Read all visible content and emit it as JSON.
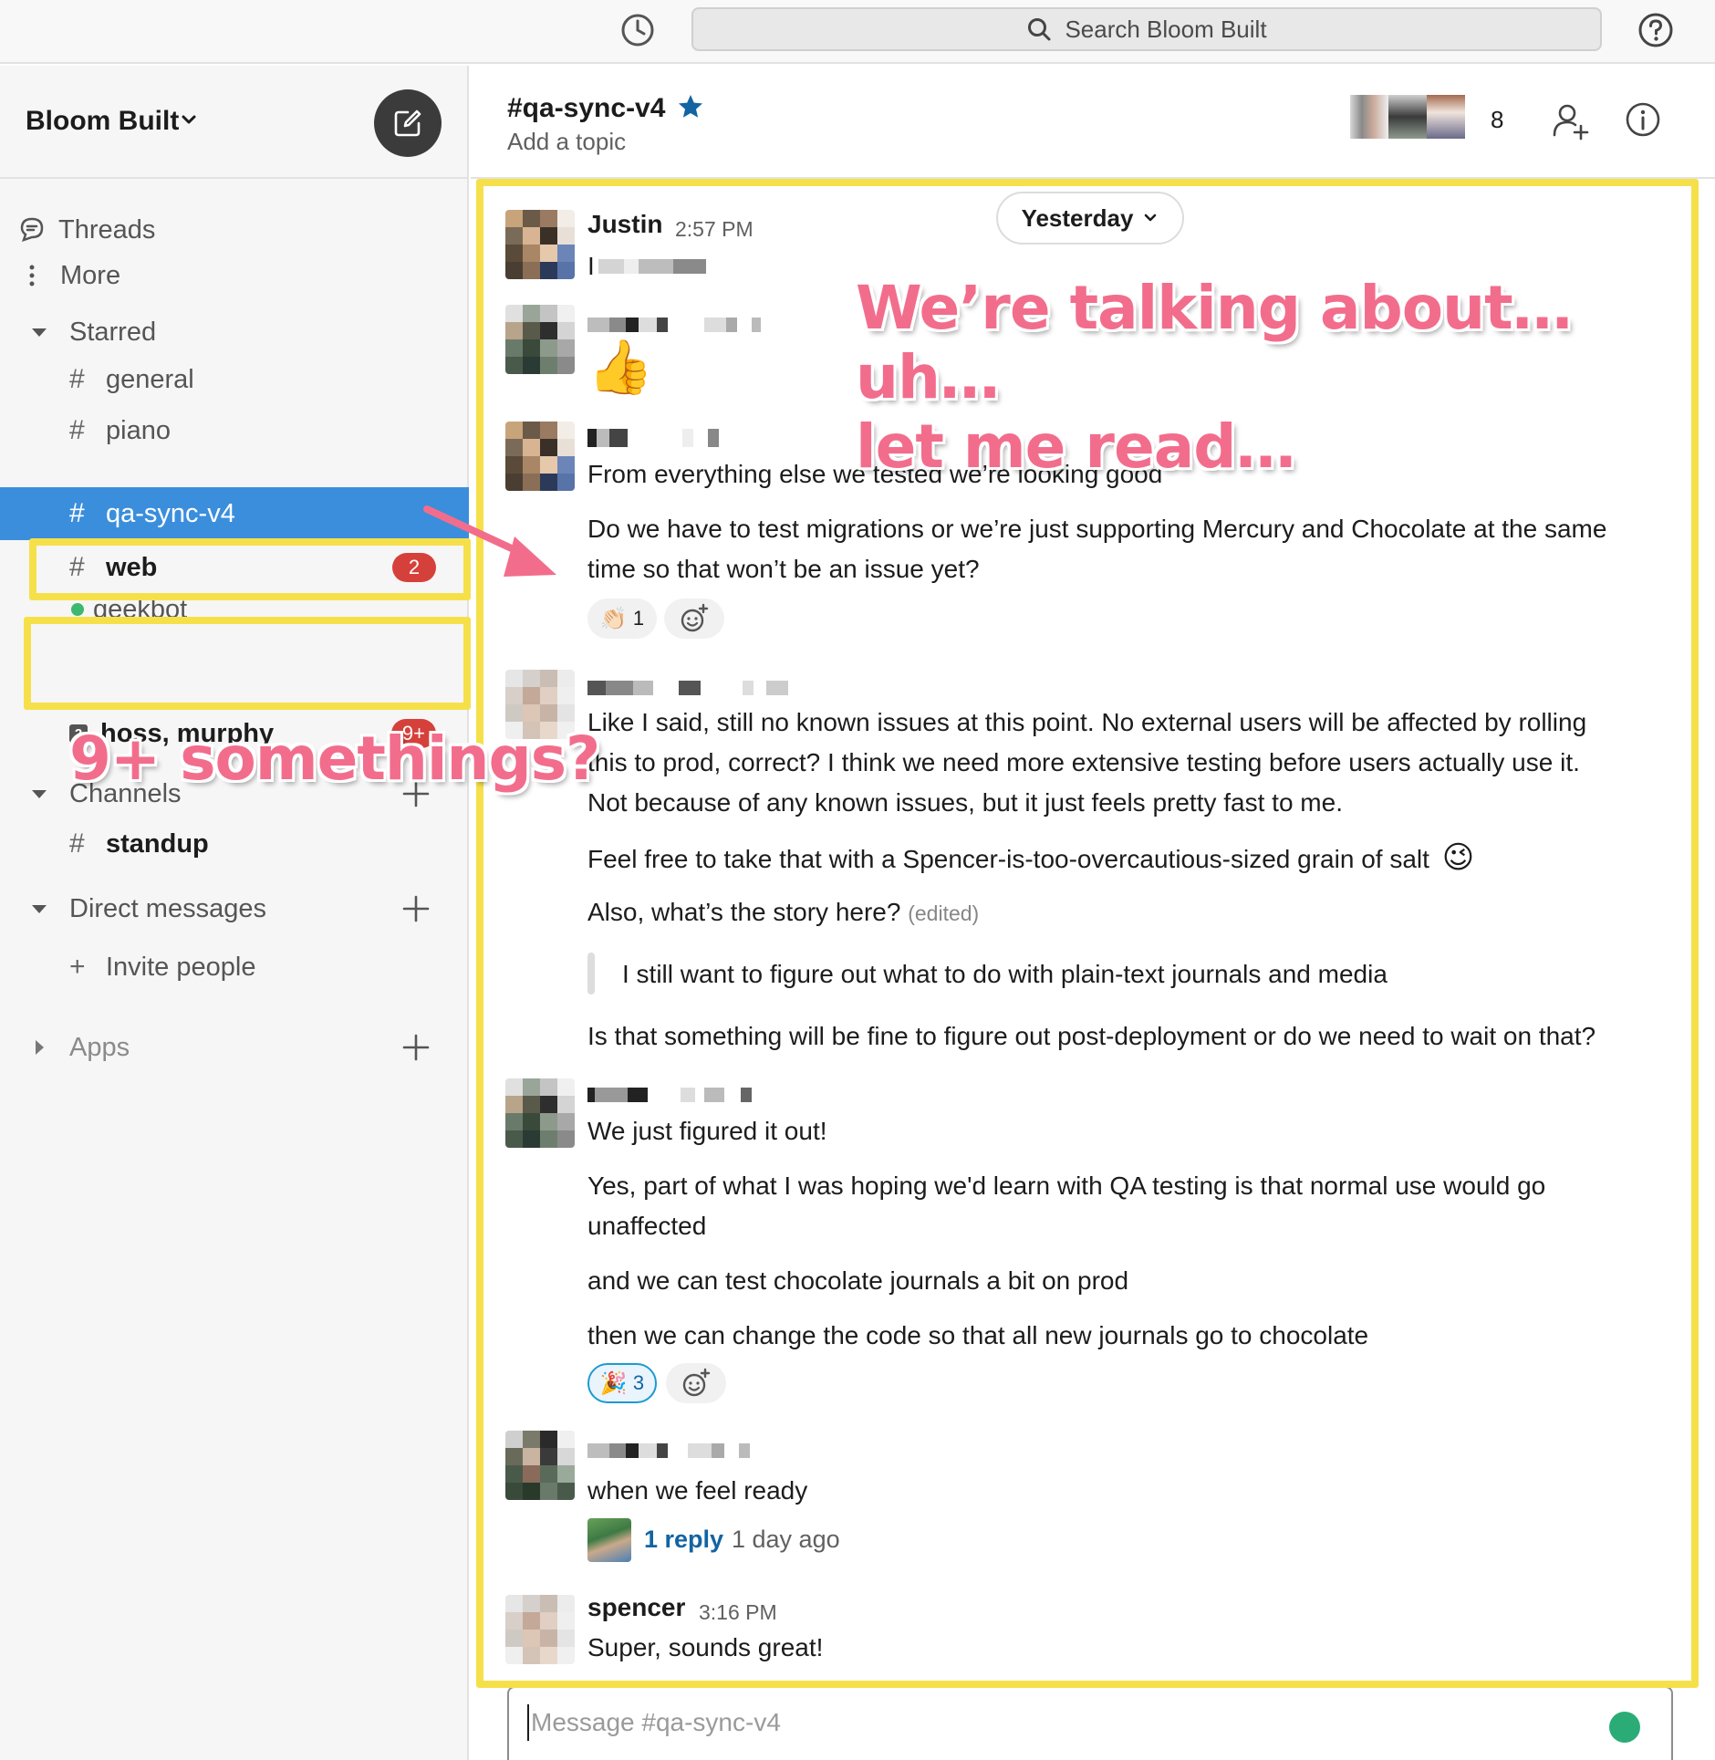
{
  "app": {
    "search_placeholder": "Search Bloom Built"
  },
  "workspace": {
    "name": "Bloom Built"
  },
  "sidebar": {
    "threads": "Threads",
    "more": "More",
    "starred_header": "Starred",
    "starred": [
      {
        "name": "general",
        "prefix": "#"
      },
      {
        "name": "piano",
        "prefix": "#"
      },
      {
        "name": "qa-sync-v4",
        "prefix": "#",
        "active": true
      },
      {
        "name": "web",
        "prefix": "#",
        "badge": "2",
        "bold": true
      },
      {
        "name": "geekbot",
        "status": "online"
      },
      {
        "name": "hoss, murphy",
        "prefix": "2",
        "badge": "9+",
        "bold": true
      }
    ],
    "channels_header": "Channels",
    "channels": [
      {
        "name": "standup",
        "prefix": "#",
        "bold": true
      }
    ],
    "dm_header": "Direct messages",
    "invite": "Invite people",
    "invite_prefix": "+",
    "apps_header": "Apps"
  },
  "channel": {
    "name": "#qa-sync-v4",
    "topic": "Add a topic",
    "member_count": "8",
    "date_divider": "Yesterday"
  },
  "messages": [
    {
      "author": "Justin",
      "time": "2:57 PM",
      "text": "I"
    },
    {
      "author": "",
      "text": "👍"
    },
    {
      "author": "",
      "lines": [
        "From everything else we tested we’re looking good",
        "Do we have to test migrations or we’re just supporting Mercury and Chocolate at the same",
        "time so that won’t be an issue yet?"
      ],
      "reactions": [
        {
          "emoji": "👏🏻",
          "count": "1"
        }
      ]
    },
    {
      "author": "",
      "lines": [
        "Like I said, still no known issues at this point. No external users will be affected by rolling",
        "this to prod, correct? I think we need more extensive testing before users actually use it.",
        "Not because of any known issues, but it just feels pretty fast to me.",
        "Feel free to take that with a Spencer-is-too-overcautious-sized grain of salt",
        "Also, what’s the story here?",
        "I still want to figure out what to do with plain-text journals and media",
        "Is that something will be fine to figure out post-deployment or do we need to wait on that?"
      ],
      "emoji": "😉",
      "edited": "(edited)"
    },
    {
      "author": "",
      "lines": [
        "We just figured it out!",
        "Yes, part of what I was hoping we'd learn with QA testing is that normal use would go",
        "unaffected",
        "and we can test chocolate journals a bit on prod",
        "then we can change the code so that all new journals go to chocolate"
      ],
      "reactions": [
        {
          "emoji": "🎉",
          "count": "3",
          "selected": true
        }
      ]
    },
    {
      "author": "",
      "lines": [
        "when we feel ready"
      ],
      "thread": {
        "replies": "1 reply",
        "when": "1 day ago"
      }
    },
    {
      "author": "spencer",
      "time": "3:16 PM",
      "lines": [
        "Super, sounds great!"
      ]
    }
  ],
  "composer": {
    "placeholder": "Message #qa-sync-v4"
  },
  "annotations": {
    "talking": [
      "We’re talking about… uh…",
      "let me read…"
    ],
    "somethings": "9+ somethings?"
  },
  "colors": {
    "active_channel": "#3b8edc",
    "badge": "#d6403b",
    "highlight": "#f6e04a",
    "annotation": "#f26d8c",
    "link": "#1264a3"
  },
  "icons": [
    "history-icon",
    "search-icon",
    "help-icon",
    "chevron-down-icon",
    "compose-icon",
    "threads-icon",
    "more-vertical-icon",
    "caret-down-icon",
    "caret-right-icon",
    "plus-icon",
    "star-icon",
    "add-user-icon",
    "info-icon",
    "add-reaction-icon"
  ]
}
